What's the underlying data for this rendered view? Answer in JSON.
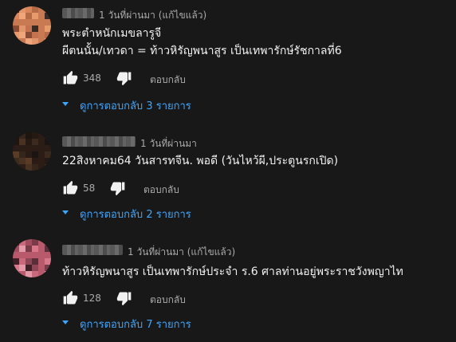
{
  "comments": [
    {
      "meta": "1 วันที่ผ่านมา (แก้ไขแล้ว)",
      "lines": [
        "พระตำหนักเมขลารูจี",
        "ผีตนนั้น/เทวดา = ท้าวหิรัญพนาสูร เป็นเทพารักษ์รัชกาลที่6"
      ],
      "likes": "348",
      "reply_label": "ตอบกลับ",
      "view_replies": "ดูการตอบกลับ 3 รายการ",
      "avatar_colors": [
        "#3a2a24",
        "#c97a52",
        "#e79a6a",
        "#b56b45",
        "#f0a57a",
        "#d8865a",
        "#8a4c33",
        "#e2946a",
        "#c47350"
      ]
    },
    {
      "meta": "1 วันที่ผ่านมา",
      "lines": [
        "22สิงหาคม64 วันสารทจีน. พอดี  (วันไหว้ผี,ประตูนรกเปิด)"
      ],
      "likes": "58",
      "reply_label": "ตอบกลับ",
      "view_replies": "ดูการตอบกลับ 2 รายการ",
      "avatar_colors": [
        "#1a1512",
        "#2b1d16",
        "#3d2a1e",
        "#241913",
        "#4a3222",
        "#1e1510",
        "#5a3b26",
        "#35251a",
        "#2a1c14"
      ]
    },
    {
      "meta": "1 วันที่ผ่านมา (แก้ไขแล้ว)",
      "lines": [
        "ท้าวหิรัญพนาสูร เป็นเทพารักษ์ประจำ ร.6 ศาลท่านอยู่พระราชวังพญาไท"
      ],
      "likes": "128",
      "reply_label": "ตอบกลับ",
      "view_replies": "ดูการตอบกลับ 7 รายการ",
      "avatar_colors": [
        "#5b2f3a",
        "#b85a6c",
        "#d9788a",
        "#7a3a48",
        "#e29aa8",
        "#a14c5e",
        "#3f2029",
        "#c96a7c",
        "#8f4656"
      ]
    }
  ],
  "icons": {
    "like": "thumb-up-icon",
    "dislike": "thumb-down-icon",
    "expand": "caret-down-icon"
  },
  "colors": {
    "background": "#181818",
    "link": "#3ea6ff",
    "muted": "#aaaaaa",
    "text": "#f1f1f1"
  }
}
